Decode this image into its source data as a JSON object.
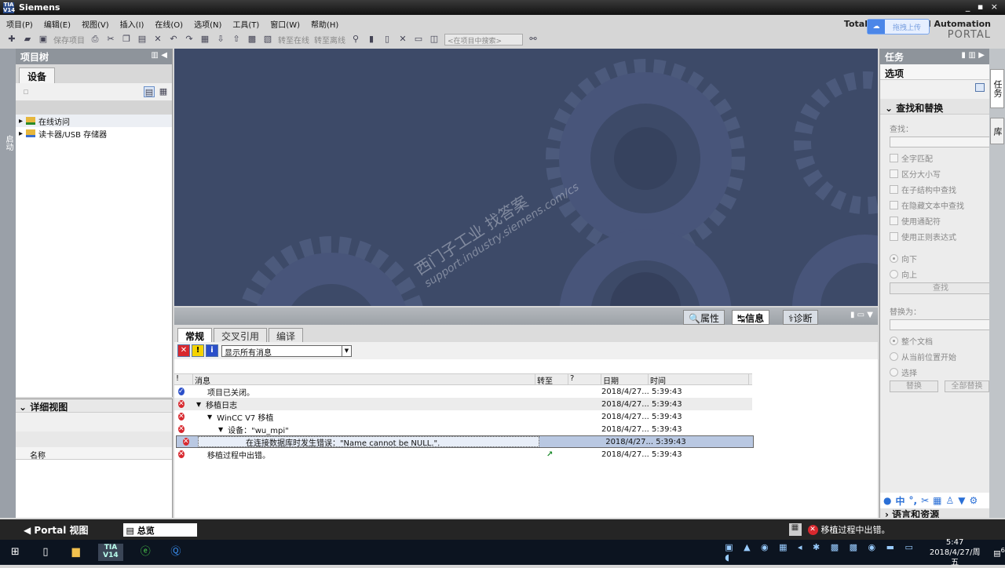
{
  "app": {
    "title": "Siemens",
    "logo": "TIA V14",
    "brand_line1": "Totally Integrated Automation",
    "brand_line2": "PORTAL",
    "window_controls": "_ ▪ ×"
  },
  "upload_widget": {
    "label": "拖拽上传",
    "icon": "cloud-icon"
  },
  "menu": [
    "项目(P)",
    "编辑(E)",
    "视图(V)",
    "插入(I)",
    "在线(O)",
    "选项(N)",
    "工具(T)",
    "窗口(W)",
    "帮助(H)"
  ],
  "toolbar": {
    "save_label": "保存项目",
    "go_online": "转至在线",
    "go_offline": "转至离线",
    "search_placeholder": "<在项目中搜索>"
  },
  "left_strip": {
    "label": "启动"
  },
  "project_tree": {
    "title": "项目树",
    "tab": "设备",
    "items": [
      {
        "label": "在线访问"
      },
      {
        "label": "读卡器/USB 存储器"
      }
    ]
  },
  "details": {
    "title": "详细视图",
    "column": "名称"
  },
  "watermark": {
    "line1": "西门子工业  找答案",
    "line2": "support.industry.siemens.com/cs"
  },
  "inspector": {
    "tabs": [
      "属性",
      "信息",
      "诊断"
    ],
    "active_tab": "信息",
    "subtabs": [
      "常规",
      "交叉引用",
      "编译"
    ],
    "active_subtab": "常规",
    "filter": "显示所有消息",
    "columns": [
      "!",
      "消息",
      "转至",
      "?",
      "日期",
      "时间"
    ],
    "rows": [
      {
        "icon": "ok",
        "indent": 0,
        "expand": "",
        "msg": "项目已关闭。",
        "goto": "",
        "date": "2018/4/27...",
        "time": "5:39:43"
      },
      {
        "icon": "err",
        "indent": 0,
        "expand": "▼",
        "msg": "移植日志",
        "goto": "",
        "date": "2018/4/27...",
        "time": "5:39:43"
      },
      {
        "icon": "err",
        "indent": 1,
        "expand": "▼",
        "msg": "WinCC V7 移植",
        "goto": "",
        "date": "2018/4/27...",
        "time": "5:39:43"
      },
      {
        "icon": "err",
        "indent": 2,
        "expand": "▼",
        "msg": "设备：\"wu_mpi\"",
        "goto": "",
        "date": "2018/4/27...",
        "time": "5:39:43"
      },
      {
        "icon": "err",
        "indent": 3,
        "expand": "",
        "msg": "在连接数据库时发生错误：\"Name cannot be NULL.\".",
        "goto": "",
        "date": "2018/4/27...",
        "time": "5:39:43"
      },
      {
        "icon": "err",
        "indent": 0,
        "expand": "",
        "msg": "移植过程中出错。",
        "goto": "↗",
        "date": "2018/4/27...",
        "time": "5:39:43"
      }
    ]
  },
  "tasks": {
    "title": "任务",
    "options": "选项",
    "find_replace": "查找和替换",
    "find_label": "查找：",
    "checkboxes": [
      "全字匹配",
      "区分大小写",
      "在子结构中查找",
      "在隐藏文本中查找",
      "使用通配符",
      "使用正则表达式"
    ],
    "direction": [
      "向下",
      "向上"
    ],
    "find_button": "查找",
    "replace_label": "替换为：",
    "scope": [
      "整个文档",
      "从当前位置开始",
      "选择"
    ],
    "replace_button": "替换",
    "replace_all_button": "全部替换",
    "languages": "语言和资源",
    "side_tabs": [
      "任务",
      "库"
    ]
  },
  "portal_bar": {
    "portal_view": "Portal 视图",
    "overview": "总览",
    "status": "移植过程中出错。"
  },
  "taskbar": {
    "time": "5:47",
    "date": "2018/4/27/周五",
    "notifications": "6",
    "tia": "TIA V14"
  }
}
